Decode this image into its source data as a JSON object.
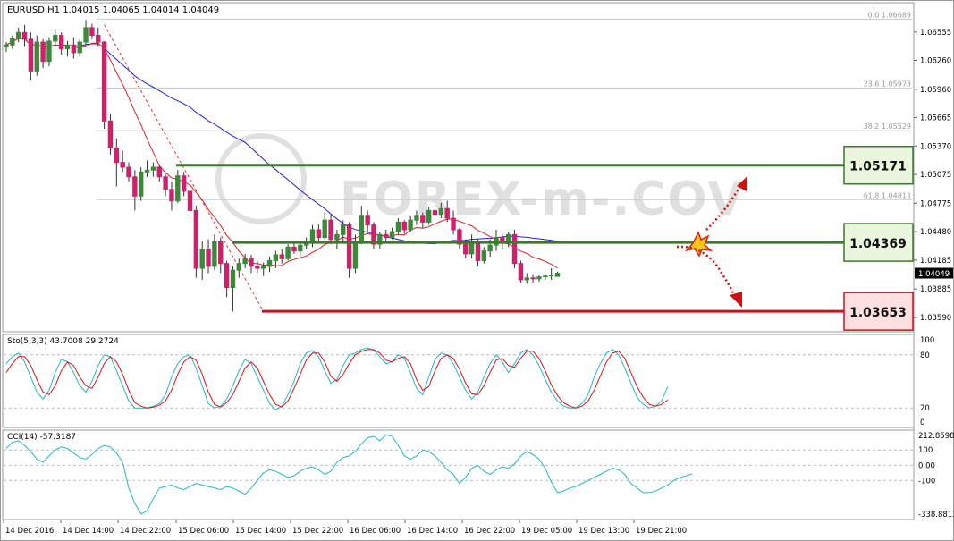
{
  "symbol_header": "EURUSD,H1  1.04015 1.04065 1.04014 1.04049",
  "watermark": "FOREX-m-.COV",
  "price_axis": {
    "min": 1.0345,
    "max": 1.0685,
    "ticks": [
      "1.06555",
      "1.06260",
      "1.05960",
      "1.05665",
      "1.05370",
      "1.05075",
      "1.04775",
      "1.04480",
      "1.04185",
      "1.03885",
      "1.03590"
    ],
    "current_price": "1.04049"
  },
  "fibonacci": [
    {
      "label": "0.0 1.06689",
      "value": 1.06689
    },
    {
      "label": "23.6 1.05973",
      "value": 1.05973
    },
    {
      "label": "38.2 1.05529",
      "value": 1.05529
    },
    {
      "label": "61.8 1.04813",
      "value": 1.04813
    }
  ],
  "levels": [
    {
      "label": "1.05171",
      "value": 1.05171,
      "color": "#3a7a2a",
      "fill": "#eaf6dd"
    },
    {
      "label": "1.04369",
      "value": 1.04369,
      "color": "#3a7a2a",
      "fill": "#eaf6dd"
    },
    {
      "label": "1.03653",
      "value": 1.03653,
      "color": "#cc1122",
      "fill": "#fde0e0"
    }
  ],
  "time_labels": [
    "14 Dec 2016",
    "14 Dec 14:00",
    "14 Dec 22:00",
    "15 Dec 06:00",
    "15 Dec 14:00",
    "15 Dec 22:00",
    "16 Dec 06:00",
    "16 Dec 14:00",
    "16 Dec 22:00",
    "19 Dec 05:00",
    "19 Dec 13:00",
    "19 Dec 21:00"
  ],
  "stochastic": {
    "label": "Sto(5,3,3) 43.7008 29.2724",
    "ticks": [
      "100",
      "80",
      "20",
      "0"
    ],
    "main_color": "#20b8c8",
    "signal_color": "#dd1111"
  },
  "cci": {
    "label": "CCI(14) -57.3187",
    "ticks": [
      "212.8598",
      "100",
      "0.00",
      "-100",
      "-338.8813"
    ],
    "color": "#20b8c8"
  },
  "colors": {
    "bull": "#3a8a3a",
    "bear": "#d0206a",
    "ma_fast": "#dd2222",
    "ma_slow": "#2222cc"
  },
  "chart_data": {
    "type": "candlestick",
    "symbol": "EURUSD",
    "timeframe": "H1",
    "candles": [
      [
        1.064,
        1.0645,
        1.0635,
        1.0642
      ],
      [
        1.0642,
        1.0652,
        1.0638,
        1.0649
      ],
      [
        1.0649,
        1.066,
        1.0645,
        1.0655
      ],
      [
        1.0655,
        1.0663,
        1.064,
        1.0648
      ],
      [
        1.0648,
        1.0655,
        1.0605,
        1.0615
      ],
      [
        1.0615,
        1.0652,
        1.061,
        1.0645
      ],
      [
        1.0645,
        1.0648,
        1.0618,
        1.0625
      ],
      [
        1.0625,
        1.065,
        1.062,
        1.0646
      ],
      [
        1.0646,
        1.0658,
        1.064,
        1.0652
      ],
      [
        1.0652,
        1.0655,
        1.0632,
        1.0638
      ],
      [
        1.0638,
        1.0646,
        1.063,
        1.0642
      ],
      [
        1.0642,
        1.065,
        1.0628,
        1.0634
      ],
      [
        1.0634,
        1.0648,
        1.063,
        1.0645
      ],
      [
        1.0645,
        1.0668,
        1.064,
        1.066
      ],
      [
        1.066,
        1.0664,
        1.0648,
        1.0652
      ],
      [
        1.0652,
        1.066,
        1.064,
        1.0645
      ],
      [
        1.0645,
        1.0646,
        1.0555,
        1.0563
      ],
      [
        1.0563,
        1.057,
        1.0528,
        1.0535
      ],
      [
        1.0535,
        1.0545,
        1.0495,
        1.052
      ],
      [
        1.052,
        1.0532,
        1.051,
        1.0515
      ],
      [
        1.0515,
        1.052,
        1.05,
        1.0505
      ],
      [
        1.0505,
        1.0512,
        1.047,
        1.0485
      ],
      [
        1.0485,
        1.0515,
        1.048,
        1.051
      ],
      [
        1.051,
        1.0522,
        1.0505,
        1.0512
      ],
      [
        1.0512,
        1.052,
        1.0505,
        1.0515
      ],
      [
        1.0515,
        1.0518,
        1.05,
        1.0505
      ],
      [
        1.0505,
        1.0508,
        1.0485,
        1.0492
      ],
      [
        1.0492,
        1.05,
        1.047,
        1.048
      ],
      [
        1.048,
        1.0512,
        1.0478,
        1.0506
      ],
      [
        1.0506,
        1.051,
        1.0485,
        1.049
      ],
      [
        1.049,
        1.0495,
        1.0465,
        1.047
      ],
      [
        1.047,
        1.0475,
        1.04,
        1.041
      ],
      [
        1.041,
        1.0438,
        1.0398,
        1.043
      ],
      [
        1.043,
        1.044,
        1.0405,
        1.0412
      ],
      [
        1.0412,
        1.0445,
        1.0408,
        1.0438
      ],
      [
        1.0438,
        1.0442,
        1.0405,
        1.0415
      ],
      [
        1.0415,
        1.0418,
        1.038,
        1.039
      ],
      [
        1.039,
        1.0412,
        1.0365,
        1.0408
      ],
      [
        1.0408,
        1.042,
        1.04,
        1.0415
      ],
      [
        1.0415,
        1.0425,
        1.041,
        1.042
      ],
      [
        1.042,
        1.0424,
        1.0405,
        1.0412
      ],
      [
        1.0412,
        1.0418,
        1.0405,
        1.041
      ],
      [
        1.041,
        1.0416,
        1.0402,
        1.0412
      ],
      [
        1.0412,
        1.0422,
        1.0406,
        1.0418
      ],
      [
        1.0418,
        1.0428,
        1.041,
        1.0424
      ],
      [
        1.0424,
        1.043,
        1.0415,
        1.042
      ],
      [
        1.042,
        1.0435,
        1.0418,
        1.0432
      ],
      [
        1.0432,
        1.0438,
        1.0425,
        1.0428
      ],
      [
        1.0428,
        1.0436,
        1.0422,
        1.0434
      ],
      [
        1.0434,
        1.0442,
        1.043,
        1.0438
      ],
      [
        1.0438,
        1.0455,
        1.0432,
        1.045
      ],
      [
        1.045,
        1.0456,
        1.0438,
        1.0442
      ],
      [
        1.0442,
        1.0468,
        1.044,
        1.046
      ],
      [
        1.046,
        1.0466,
        1.0435,
        1.044
      ],
      [
        1.044,
        1.045,
        1.043,
        1.0445
      ],
      [
        1.0445,
        1.046,
        1.0438,
        1.0455
      ],
      [
        1.0455,
        1.0458,
        1.04,
        1.041
      ],
      [
        1.041,
        1.0445,
        1.0405,
        1.0438
      ],
      [
        1.0438,
        1.0475,
        1.0435,
        1.0465
      ],
      [
        1.0465,
        1.047,
        1.0448,
        1.0455
      ],
      [
        1.0455,
        1.0458,
        1.043,
        1.0435
      ],
      [
        1.0435,
        1.0448,
        1.043,
        1.0445
      ],
      [
        1.0445,
        1.045,
        1.0438,
        1.0442
      ],
      [
        1.0442,
        1.0452,
        1.044,
        1.0448
      ],
      [
        1.0448,
        1.0462,
        1.0445,
        1.0458
      ],
      [
        1.0458,
        1.046,
        1.0446,
        1.045
      ],
      [
        1.045,
        1.0465,
        1.0448,
        1.046
      ],
      [
        1.046,
        1.047,
        1.0455,
        1.0465
      ],
      [
        1.0465,
        1.0468,
        1.0452,
        1.0458
      ],
      [
        1.0458,
        1.0474,
        1.0455,
        1.047
      ],
      [
        1.047,
        1.0476,
        1.046,
        1.0466
      ],
      [
        1.0466,
        1.0478,
        1.0462,
        1.0472
      ],
      [
        1.0472,
        1.048,
        1.0458,
        1.0462
      ],
      [
        1.0462,
        1.047,
        1.0445,
        1.045
      ],
      [
        1.045,
        1.0452,
        1.043,
        1.0435
      ],
      [
        1.0435,
        1.044,
        1.042,
        1.0425
      ],
      [
        1.0425,
        1.0445,
        1.042,
        1.0438
      ],
      [
        1.0438,
        1.044,
        1.0412,
        1.0418
      ],
      [
        1.0418,
        1.0432,
        1.0415,
        1.0428
      ],
      [
        1.0428,
        1.044,
        1.0422,
        1.0434
      ],
      [
        1.0434,
        1.045,
        1.0428,
        1.0442
      ],
      [
        1.0442,
        1.0446,
        1.043,
        1.0436
      ],
      [
        1.0436,
        1.0448,
        1.0432,
        1.0445
      ],
      [
        1.0445,
        1.045,
        1.041,
        1.0415
      ],
      [
        1.0415,
        1.0418,
        1.0395,
        1.0398
      ],
      [
        1.0398,
        1.0405,
        1.0394,
        1.04
      ],
      [
        1.04,
        1.0404,
        1.0395,
        1.0399
      ],
      [
        1.0399,
        1.0403,
        1.0396,
        1.0401
      ],
      [
        1.0401,
        1.0404,
        1.0398,
        1.0402
      ],
      [
        1.0402,
        1.041,
        1.0398,
        1.0403
      ],
      [
        1.04015,
        1.04065,
        1.04014,
        1.04049
      ]
    ],
    "stochastic_main": [
      70,
      78,
      82,
      72,
      55,
      38,
      30,
      40,
      60,
      75,
      72,
      60,
      45,
      38,
      50,
      68,
      80,
      78,
      62,
      45,
      28,
      20,
      20,
      20,
      22,
      25,
      35,
      55,
      70,
      78,
      80,
      65,
      45,
      25,
      20,
      22,
      30,
      45,
      62,
      75,
      70,
      55,
      40,
      25,
      18,
      22,
      35,
      50,
      70,
      82,
      85,
      78,
      62,
      48,
      52,
      68,
      80,
      82,
      86,
      88,
      85,
      78,
      70,
      72,
      80,
      76,
      60,
      42,
      35,
      55,
      75,
      82,
      80,
      70,
      55,
      40,
      30,
      38,
      55,
      70,
      80,
      72,
      60,
      70,
      82,
      86,
      80,
      68,
      52,
      38,
      28,
      22,
      20,
      20,
      25,
      35,
      55,
      70,
      82,
      86,
      80,
      65,
      48,
      32,
      24,
      20,
      22,
      28,
      44
    ],
    "stochastic_signal": [
      60,
      70,
      78,
      78,
      68,
      52,
      38,
      35,
      45,
      62,
      72,
      68,
      55,
      45,
      42,
      55,
      70,
      78,
      72,
      58,
      40,
      26,
      22,
      20,
      21,
      23,
      28,
      40,
      58,
      72,
      78,
      74,
      58,
      38,
      24,
      21,
      26,
      35,
      50,
      65,
      72,
      65,
      50,
      35,
      24,
      21,
      28,
      42,
      58,
      74,
      82,
      82,
      72,
      56,
      50,
      58,
      70,
      80,
      84,
      86,
      86,
      82,
      74,
      72,
      76,
      78,
      70,
      52,
      40,
      44,
      62,
      76,
      80,
      76,
      64,
      48,
      36,
      35,
      45,
      60,
      74,
      76,
      68,
      66,
      76,
      84,
      84,
      76,
      62,
      46,
      34,
      26,
      22,
      20,
      22,
      28,
      40,
      56,
      72,
      82,
      84,
      76,
      60,
      44,
      32,
      24,
      22,
      24,
      29
    ],
    "cci": [
      110,
      150,
      160,
      130,
      90,
      40,
      20,
      60,
      100,
      120,
      110,
      80,
      50,
      40,
      70,
      110,
      130,
      120,
      80,
      20,
      -150,
      -250,
      -320,
      -300,
      -220,
      -150,
      -140,
      -130,
      -150,
      -160,
      -140,
      -120,
      -130,
      -140,
      -150,
      -160,
      -140,
      -150,
      -170,
      -190,
      -150,
      -100,
      -50,
      -30,
      -40,
      -60,
      -80,
      -70,
      -40,
      -20,
      -10,
      -30,
      -60,
      -40,
      20,
      50,
      60,
      90,
      140,
      180,
      190,
      160,
      200,
      190,
      130,
      60,
      40,
      60,
      100,
      90,
      60,
      20,
      -30,
      -60,
      -120,
      -80,
      -20,
      0,
      -40,
      -60,
      -30,
      -10,
      -20,
      10,
      60,
      90,
      70,
      40,
      -20,
      -110,
      -180,
      -170,
      -150,
      -140,
      -120,
      -100,
      -80,
      -60,
      -40,
      -20,
      -30,
      -60,
      -120,
      -150,
      -180,
      -180,
      -170,
      -150,
      -130,
      -100,
      -80,
      -70,
      -57
    ]
  }
}
